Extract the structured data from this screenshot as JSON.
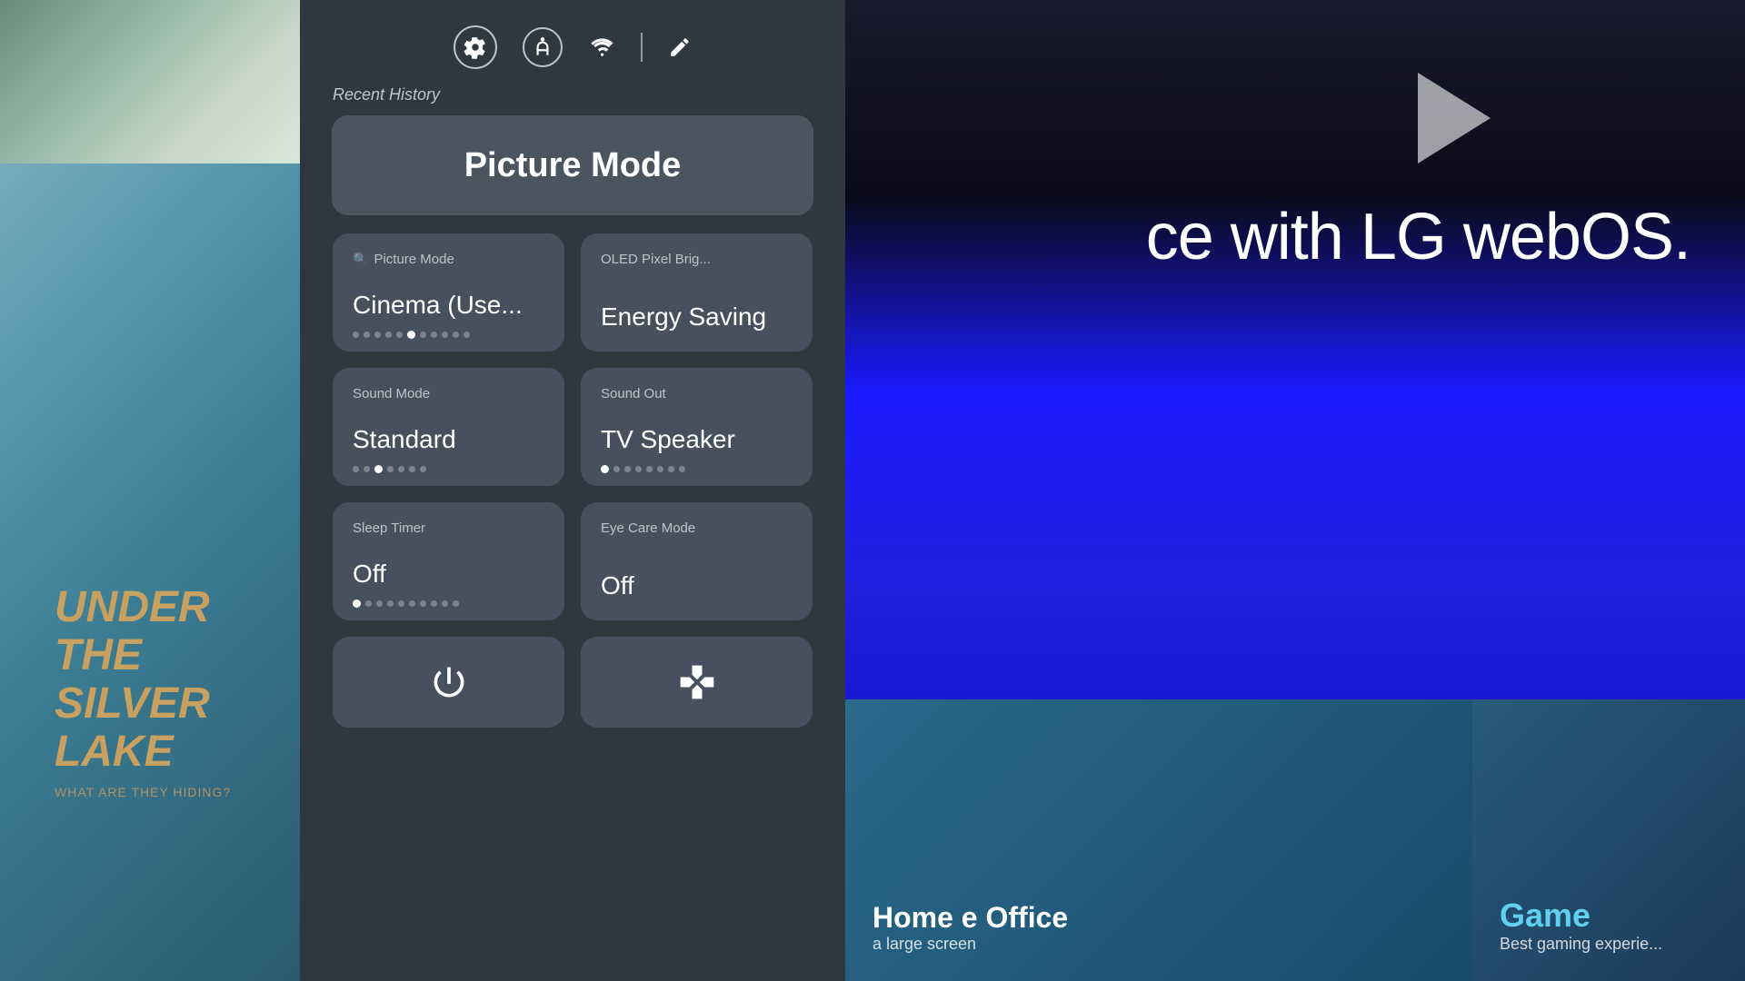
{
  "background": {
    "left_color_start": "#8ab8c8",
    "right_color": "#1a1aff"
  },
  "left_content": {
    "movie_title_line1": "UNDER",
    "movie_title_line2": "THE",
    "movie_title_line3": "SILVER",
    "movie_title_line4": "LAK",
    "movie_subtitle": "WHAT ARE THEY HIDING?"
  },
  "right_content": {
    "lg_text": "ce with LG webOS."
  },
  "bottom_right": {
    "home_office_title": "Home e Office",
    "home_office_sub": "a large screen",
    "game_title": "Game",
    "game_sub": "Best gaming experie..."
  },
  "overlay": {
    "recent_history_label": "Recent History",
    "picture_mode_btn_label": "Picture Mode",
    "top_icons": {
      "settings": "⚙",
      "accessibility": "♿",
      "wifi": "WiFi",
      "edit": "✏"
    },
    "tiles": {
      "tile1": {
        "subtitle": "Picture Mode",
        "value": "Cinema (Use...",
        "active_dot": 5
      },
      "tile2": {
        "subtitle": "OLED Pixel Brig...",
        "value": "Energy Saving",
        "active_dot": 0
      },
      "tile3": {
        "subtitle": "Sound Mode",
        "value": "Standard",
        "active_dot": 2
      },
      "tile4": {
        "subtitle": "Sound Out",
        "value": "TV Speaker",
        "active_dot": 0
      },
      "tile5": {
        "subtitle": "Sleep Timer",
        "value": "Off",
        "active_dot": 0
      },
      "tile6": {
        "subtitle": "Eye Care Mode",
        "value": "Off",
        "active_dot": 0
      }
    },
    "icon_tiles": {
      "power": "⏻",
      "gamepad": "🎮"
    }
  }
}
